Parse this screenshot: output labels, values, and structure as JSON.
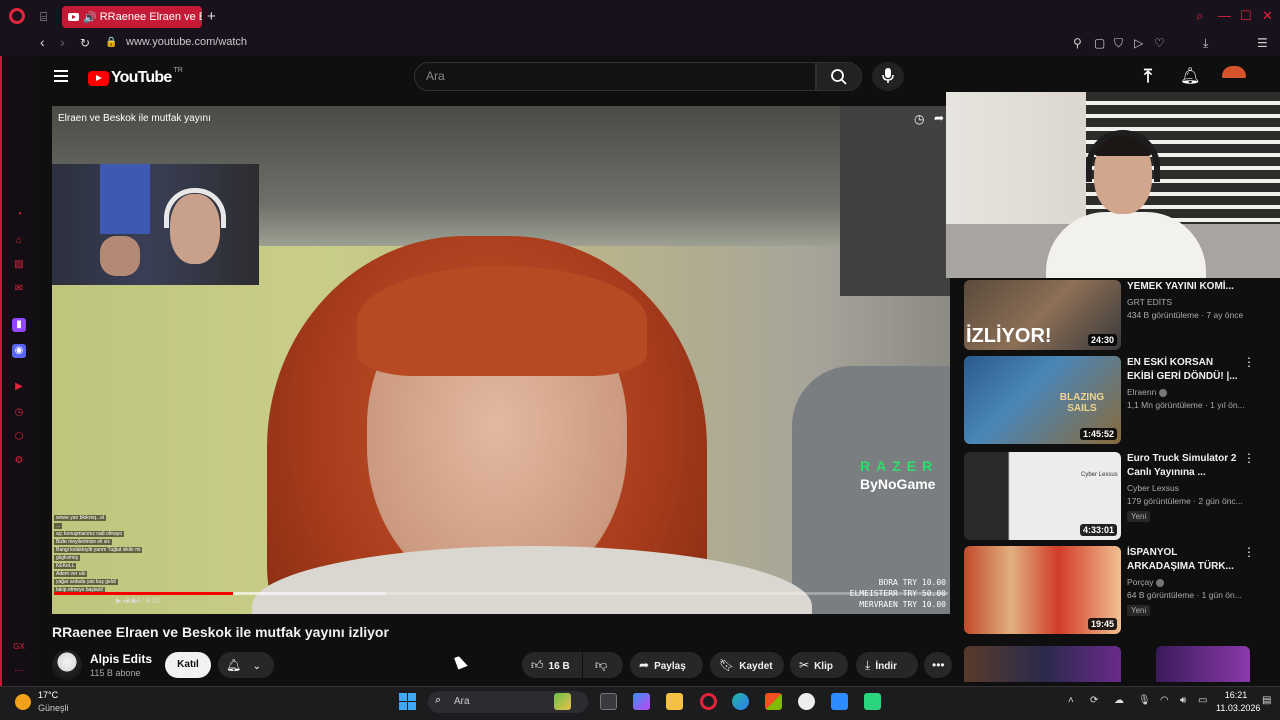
{
  "browser": {
    "tab_title": "RRaenee Elraen ve Bes",
    "new_tab": "+",
    "url": "www.youtube.com/watch",
    "profile_initial": "E",
    "ai_label": "AI",
    "accent": "#c41a35"
  },
  "youtube": {
    "logo_text": "YouTube",
    "country": "TR",
    "search_placeholder": "Ara"
  },
  "video": {
    "overlay_title": "Elraen ve Beskok ile mutfak yayını",
    "title": "RRaenee Elraen ve Beskok ile mutfak yayını izliyor",
    "time": "1:24 / 8:10",
    "progress_played": 0.2,
    "progress_buffered": 0.37,
    "razer": "RAZER",
    "bynogame": "ByNoGame",
    "donations": [
      "BORA  TRY 10.00",
      "ELMEISTERR  TRY 50.00",
      "MERVRAEN  TRY 10.00"
    ],
    "chat": [
      "wowe yan blokreq...el",
      "...",
      "açı konuşmacınız radi olmayo",
      "Bizle meyilerimize eli siz",
      "Bangi kolaktoyib yarım Tuğlat sikile mi",
      "gkgkvimiş",
      "KEKeLL",
      "Adem ver ulo",
      "yağar ardada yas kuş geldi",
      "takip etmeye başladı!"
    ]
  },
  "channel": {
    "name": "Alpis Edits",
    "subs": "115 B abone",
    "join": "Katıl"
  },
  "actions": {
    "likes": "16 B",
    "share": "Paylaş",
    "save": "Kaydet",
    "clip": "Klip",
    "download": "İndir"
  },
  "recommendations": [
    {
      "title": "YEMEK YAYINI KOMİ...",
      "channel": "GRT EDİTS",
      "stats": "434 B görüntüleme · 7 ay önce",
      "duration": "24:30",
      "badge": "",
      "thumb_text": "İZLİYOR!"
    },
    {
      "title": "EN ESKİ KORSAN EKİBİ GERİ DÖNDÜ! |...",
      "channel": "Elraenn",
      "stats": "1,1 Mn görüntüleme · 1 yıl ön...",
      "duration": "1:45:52",
      "badge": "",
      "thumb_text": "BLAZING SAILS"
    },
    {
      "title": "Euro Truck Simulator 2 Canlı Yayınına ...",
      "channel": "Cyber Lexsus",
      "stats": "179 görüntüleme · 2 gün önc...",
      "duration": "4:33:01",
      "badge": "Yeni",
      "thumb_text": "Cyber Lexsus"
    },
    {
      "title": "İSPANYOL ARKADAŞIMA TÜRK...",
      "channel": "Porçay",
      "stats": "64 B görüntüleme · 1 gün ön...",
      "duration": "19:45",
      "badge": "Yeni",
      "thumb_text": ""
    }
  ],
  "taskbar": {
    "temp": "17°C",
    "weather": "Güneşli",
    "search": "Ara",
    "time": "16:21",
    "date": "11.03.2026"
  }
}
